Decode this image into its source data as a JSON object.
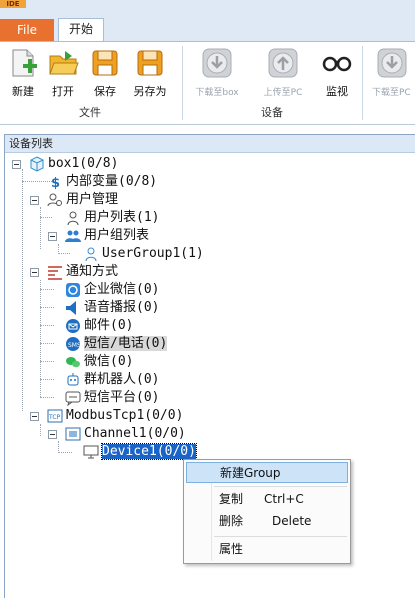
{
  "app": {
    "logo_text": "IDE"
  },
  "tabs": {
    "file": "File",
    "start": "开始"
  },
  "ribbon": {
    "file_group": {
      "label": "文件",
      "buttons": [
        {
          "label": "新建",
          "icon": "new-file-icon"
        },
        {
          "label": "打开",
          "icon": "open-folder-icon"
        },
        {
          "label": "保存",
          "icon": "save-icon"
        },
        {
          "label": "另存为",
          "icon": "save-as-icon"
        }
      ]
    },
    "device_group": {
      "label": "设备",
      "buttons": [
        {
          "label": "下载至box",
          "icon": "download-icon",
          "disabled": true
        },
        {
          "label": "上传至PC",
          "icon": "upload-icon",
          "disabled": true
        },
        {
          "label": "监视",
          "icon": "monitor-glasses-icon",
          "disabled": false
        }
      ]
    },
    "extra": {
      "label": "下载至PC",
      "icon": "download-icon",
      "disabled": true
    }
  },
  "panel": {
    "title": "设备列表",
    "tree": [
      {
        "name": "box-node",
        "label": "box1(0/8)",
        "icon": "cube-icon"
      },
      {
        "name": "internal-vars-node",
        "label": "内部变量(0/8)",
        "icon": "dollar-icon"
      },
      {
        "name": "user-mgmt-node",
        "label": "用户管理",
        "icon": "user-gear-icon"
      },
      {
        "name": "user-list-node",
        "label": "用户列表(1)",
        "icon": "user-icon"
      },
      {
        "name": "user-group-list-node",
        "label": "用户组列表",
        "icon": "user-group-icon"
      },
      {
        "name": "usergroup1-node",
        "label": "UserGroup1(1)",
        "icon": "user-icon"
      },
      {
        "name": "notify-node",
        "label": "通知方式",
        "icon": "notify-icon"
      },
      {
        "name": "wecom-node",
        "label": "企业微信(0)",
        "icon": "wecom-icon"
      },
      {
        "name": "voice-node",
        "label": "语音播报(0)",
        "icon": "speaker-icon"
      },
      {
        "name": "email-node",
        "label": "邮件(0)",
        "icon": "mail-icon"
      },
      {
        "name": "sms-phone-node",
        "label": "短信/电话(0)",
        "icon": "sms-icon"
      },
      {
        "name": "wechat-node",
        "label": "微信(0)",
        "icon": "wechat-icon"
      },
      {
        "name": "robot-node",
        "label": "群机器人(0)",
        "icon": "robot-icon"
      },
      {
        "name": "sms-platform-node",
        "label": "短信平台(0)",
        "icon": "sms-platform-icon"
      },
      {
        "name": "modbus-node",
        "label": "ModbusTcp1(0/0)",
        "icon": "tcp-icon"
      },
      {
        "name": "channel-node",
        "label": "Channel1(0/0)",
        "icon": "channel-icon"
      },
      {
        "name": "device-node",
        "label": "Device1(0/0)",
        "icon": "monitor-icon"
      }
    ]
  },
  "context_menu": {
    "items": [
      {
        "label": "新建Group",
        "shortcut": ""
      },
      {
        "label": "复制",
        "shortcut": "Ctrl+C"
      },
      {
        "label": "删除",
        "shortcut": "Delete"
      },
      {
        "label": "属性",
        "shortcut": ""
      }
    ]
  },
  "colors": {
    "file_tab": "#e8712f",
    "selection": "#1b64c7",
    "menu_highlight": "#cde3f7",
    "panel_header": "#dce8f6"
  }
}
